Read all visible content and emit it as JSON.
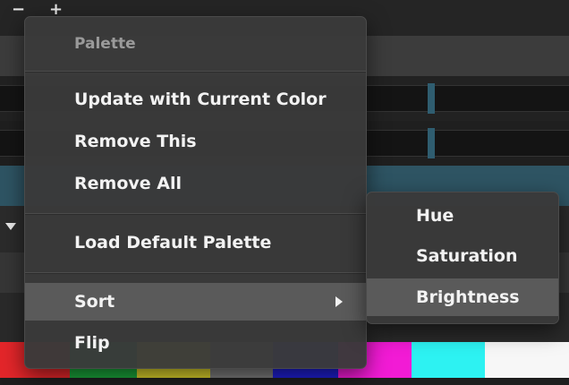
{
  "toolbar": {
    "minus_label": "−",
    "plus_label": "+"
  },
  "palette_swatches": [
    "#e3262a",
    "#1aa33a",
    "#d7cc2a",
    "#7a7a7a",
    "#1f1fd0",
    "#f21bd5",
    "#2df2f2",
    "#f7f7f7"
  ],
  "context_menu": {
    "header": "Palette",
    "items": {
      "update_current": "Update with Current Color",
      "remove_this": "Remove This",
      "remove_all": "Remove All",
      "load_default": "Load Default Palette",
      "sort": "Sort",
      "flip": "Flip"
    }
  },
  "sort_submenu": {
    "hue": "Hue",
    "saturation": "Saturation",
    "brightness": "Brightness"
  },
  "colors": {
    "menu_bg": "#3a3a3a",
    "highlight": "#5a5a5a",
    "accent_row": "#2e5463"
  }
}
